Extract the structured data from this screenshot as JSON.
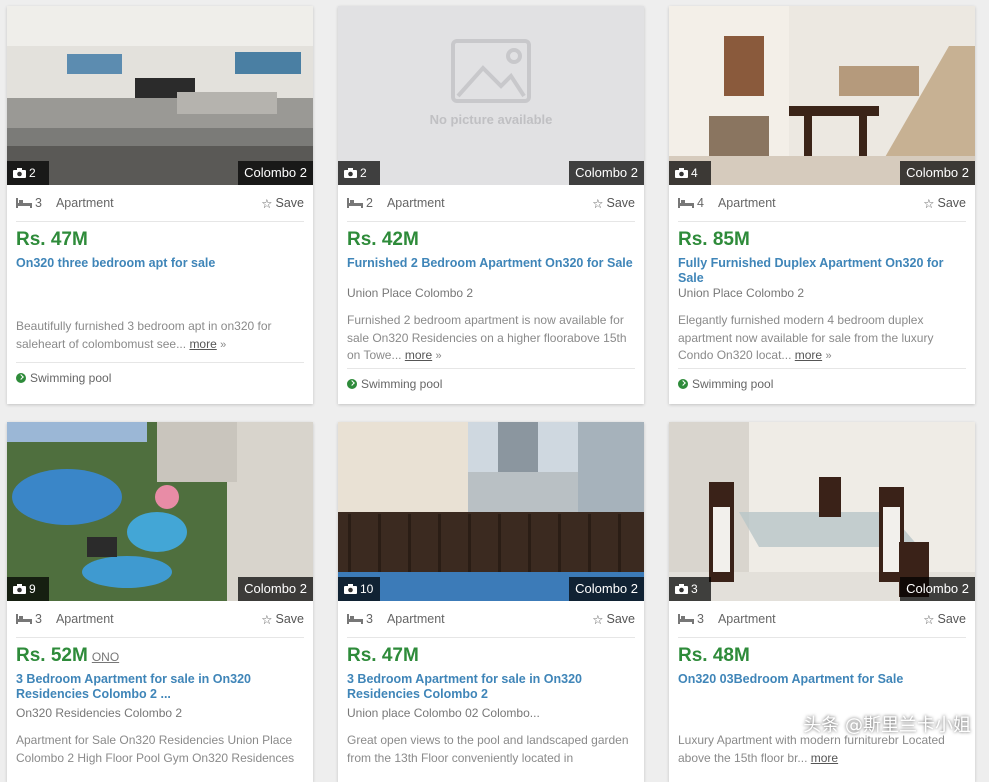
{
  "listings": [
    {
      "photo_count": "2",
      "location_badge": "Colombo 2",
      "beds": "3",
      "type": "Apartment",
      "save_label": "Save",
      "price": "Rs. 47M",
      "price_note": "",
      "title": "On320 three bedroom apt for sale",
      "address": "",
      "description": "Beautifully furnished 3 bedroom apt in on320 for saleheart of colombomust see...",
      "more_label": "more",
      "feature": "Swimming pool",
      "photo": "living-room"
    },
    {
      "photo_count": "2",
      "location_badge": "Colombo 2",
      "beds": "2",
      "type": "Apartment",
      "save_label": "Save",
      "price": "Rs. 42M",
      "price_note": "",
      "title": "Furnished 2 Bedroom Apartment On320 for Sale",
      "address": "Union Place Colombo 2",
      "description": "Furnished 2 bedroom apartment is now available for sale On320 Residencies on a higher floorabove 15th on Towe...",
      "more_label": "more",
      "feature": "Swimming pool",
      "photo": "placeholder",
      "placeholder_text": "No picture available"
    },
    {
      "photo_count": "4",
      "location_badge": "Colombo 2",
      "beds": "4",
      "type": "Apartment",
      "save_label": "Save",
      "price": "Rs. 85M",
      "price_note": "",
      "title": "Fully Furnished Duplex Apartment On320 for Sale",
      "address": "Union Place Colombo 2",
      "description": "Elegantly furnished modern 4 bedroom duplex apartment now available for sale from the luxury Condo On320 locat...",
      "more_label": "more",
      "feature": "Swimming pool",
      "photo": "dining-stairs"
    },
    {
      "photo_count": "9",
      "location_badge": "Colombo 2",
      "beds": "3",
      "type": "Apartment",
      "save_label": "Save",
      "price": "Rs. 52M",
      "price_note": "ONO",
      "title": "3 Bedroom Apartment for sale in On320 Residencies Colombo 2 ...",
      "address": "On320 Residencies Colombo 2",
      "description": "Apartment for Sale On320 Residencies Union Place Colombo 2 High Floor Pool Gym On320 Residences",
      "more_label": "",
      "feature": "",
      "photo": "pool-aerial"
    },
    {
      "photo_count": "10",
      "location_badge": "Colombo 2",
      "beds": "3",
      "type": "Apartment",
      "save_label": "Save",
      "price": "Rs. 47M",
      "price_note": "",
      "title": "3 Bedroom Apartment for sale in On320 Residencies Colombo 2",
      "address": "Union place Colombo 02 Colombo...",
      "description": "Great open views to the pool and landscaped garden from the 13th Floor conveniently located in",
      "more_label": "",
      "feature": "",
      "photo": "balcony-view"
    },
    {
      "photo_count": "3",
      "location_badge": "Colombo 2",
      "beds": "3",
      "type": "Apartment",
      "save_label": "Save",
      "price": "Rs. 48M",
      "price_note": "",
      "title": "On320 03Bedroom Apartment for Sale",
      "address": "",
      "description": "Luxury Apartment with modern furniturebr Located above the 15th floor br...",
      "more_label": "more",
      "feature": "",
      "photo": "dining-table"
    }
  ],
  "watermark": "头条 @斯里兰卡小姐",
  "colors": {
    "price_green": "#2e8b3a",
    "title_blue": "#3f85b8",
    "badge_bg": "#000000"
  },
  "icons": {
    "photo_count": "camera-icon",
    "beds": "bed-icon",
    "save": "star-outline-icon",
    "feature": "check-circle-icon"
  }
}
